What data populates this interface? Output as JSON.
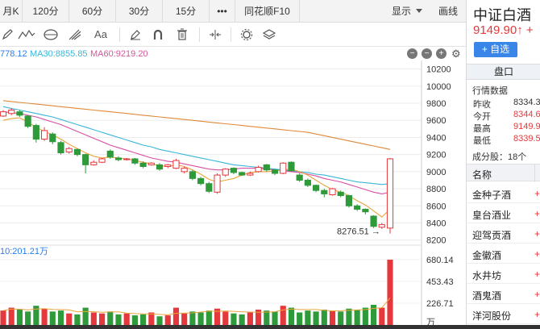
{
  "topbar": {
    "periods": [
      "月K",
      "120分",
      "60分",
      "30分",
      "15分",
      "•••",
      "同花顺F10"
    ],
    "display_label": "显示",
    "draw_label": "画线"
  },
  "toolbar": {
    "tools": [
      {
        "icon": "pencil-icon"
      },
      {
        "icon": "wave-line-icon"
      },
      {
        "icon": "cycle-icon"
      },
      {
        "icon": "fork-icon"
      },
      {
        "icon": "text-icon",
        "label": "Aa"
      },
      {
        "icon": "eraser-icon"
      },
      {
        "icon": "magnet-icon"
      },
      {
        "icon": "trash-icon"
      },
      {
        "icon": "split-icon"
      },
      {
        "icon": "settings-icon"
      },
      {
        "icon": "layers-icon"
      }
    ]
  },
  "ma_legend": {
    "ma_lead": "778.12",
    "ma30": "MA30:8855.85",
    "ma60": "MA60:9219.20",
    "colors": {
      "ma_lead": "#2a7be8",
      "ma30": "#39b6d8",
      "ma60": "#d6569b",
      "ma_long": "#e0893a",
      "ma_short": "#e9a53b",
      "ma_mid": "#d84fa3"
    }
  },
  "chart_data": {
    "type": "candlestick",
    "y_ticks": [
      "10200",
      "10000",
      "9800",
      "9600",
      "9400",
      "9200",
      "9000",
      "8800",
      "8600",
      "8400",
      "8200"
    ],
    "ylim": [
      8150,
      10300
    ],
    "min_marker": "8276.51",
    "volume_label": "10:201.21万",
    "volume_ticks": [
      "680.14",
      "453.43",
      "226.71",
      "万"
    ],
    "volume_max": 680.14,
    "candles": [
      {
        "o": 9650,
        "c": 9700,
        "h": 9720,
        "l": 9640
      },
      {
        "o": 9680,
        "c": 9720,
        "h": 9740,
        "l": 9660
      },
      {
        "o": 9700,
        "c": 9660,
        "h": 9720,
        "l": 9640
      },
      {
        "o": 9650,
        "c": 9530,
        "h": 9660,
        "l": 9510
      },
      {
        "o": 9540,
        "c": 9380,
        "h": 9560,
        "l": 9340
      },
      {
        "o": 9380,
        "c": 9480,
        "h": 9520,
        "l": 9360
      },
      {
        "o": 9440,
        "c": 9350,
        "h": 9460,
        "l": 9320
      },
      {
        "o": 9340,
        "c": 9220,
        "h": 9360,
        "l": 9200
      },
      {
        "o": 9230,
        "c": 9270,
        "h": 9290,
        "l": 9210
      },
      {
        "o": 9260,
        "c": 9200,
        "h": 9270,
        "l": 9180
      },
      {
        "o": 9200,
        "c": 9080,
        "h": 9210,
        "l": 8980
      },
      {
        "o": 9080,
        "c": 9110,
        "h": 9130,
        "l": 9070
      },
      {
        "o": 9110,
        "c": 9150,
        "h": 9160,
        "l": 9100
      },
      {
        "o": 9240,
        "c": 9170,
        "h": 9260,
        "l": 9150
      },
      {
        "o": 9160,
        "c": 9140,
        "h": 9180,
        "l": 9120
      },
      {
        "o": 9140,
        "c": 9150,
        "h": 9160,
        "l": 9130
      },
      {
        "o": 9150,
        "c": 9100,
        "h": 9160,
        "l": 9080
      },
      {
        "o": 9100,
        "c": 9060,
        "h": 9120,
        "l": 9040
      },
      {
        "o": 9080,
        "c": 9100,
        "h": 9110,
        "l": 9070
      },
      {
        "o": 9080,
        "c": 9030,
        "h": 9100,
        "l": 9010
      },
      {
        "o": 9060,
        "c": 9080,
        "h": 9090,
        "l": 9040
      },
      {
        "o": 9040,
        "c": 9130,
        "h": 9150,
        "l": 9030
      },
      {
        "o": 9000,
        "c": 9040,
        "h": 9060,
        "l": 8980
      },
      {
        "o": 9000,
        "c": 8920,
        "h": 9020,
        "l": 8900
      },
      {
        "o": 8920,
        "c": 8860,
        "h": 8940,
        "l": 8840
      },
      {
        "o": 8860,
        "c": 8770,
        "h": 8880,
        "l": 8750
      },
      {
        "o": 8760,
        "c": 8960,
        "h": 8980,
        "l": 8740
      },
      {
        "o": 8960,
        "c": 9030,
        "h": 9040,
        "l": 8940
      },
      {
        "o": 9040,
        "c": 8990,
        "h": 9050,
        "l": 8970
      },
      {
        "o": 8990,
        "c": 8960,
        "h": 9000,
        "l": 8950
      },
      {
        "o": 8960,
        "c": 8980,
        "h": 9000,
        "l": 8950
      },
      {
        "o": 9000,
        "c": 9050,
        "h": 9070,
        "l": 8990
      },
      {
        "o": 9080,
        "c": 9020,
        "h": 9090,
        "l": 9000
      },
      {
        "o": 9020,
        "c": 8980,
        "h": 9030,
        "l": 8960
      },
      {
        "o": 8980,
        "c": 9100,
        "h": 9110,
        "l": 8970
      },
      {
        "o": 9110,
        "c": 9010,
        "h": 9120,
        "l": 9000
      },
      {
        "o": 8960,
        "c": 8900,
        "h": 8980,
        "l": 8880
      },
      {
        "o": 8900,
        "c": 8840,
        "h": 8920,
        "l": 8820
      },
      {
        "o": 8840,
        "c": 8780,
        "h": 8850,
        "l": 8760
      },
      {
        "o": 8780,
        "c": 8740,
        "h": 8800,
        "l": 8700
      },
      {
        "o": 8730,
        "c": 8800,
        "h": 8810,
        "l": 8720
      },
      {
        "o": 8760,
        "c": 8720,
        "h": 8780,
        "l": 8700
      },
      {
        "o": 8720,
        "c": 8600,
        "h": 8730,
        "l": 8580
      },
      {
        "o": 8600,
        "c": 8560,
        "h": 8620,
        "l": 8540
      },
      {
        "o": 8560,
        "c": 8530,
        "h": 8570,
        "l": 8500
      },
      {
        "o": 8480,
        "c": 8360,
        "h": 8490,
        "l": 8340
      },
      {
        "o": 8350,
        "c": 8380,
        "h": 8400,
        "l": 8330
      },
      {
        "o": 8340,
        "c": 9150,
        "h": 9160,
        "l": 8276
      }
    ],
    "volumes": [
      150,
      180,
      160,
      140,
      200,
      170,
      140,
      150,
      120,
      110,
      180,
      130,
      120,
      140,
      110,
      120,
      100,
      110,
      130,
      90,
      100,
      180,
      120,
      140,
      130,
      150,
      170,
      140,
      120,
      110,
      130,
      160,
      150,
      140,
      200,
      180,
      130,
      150,
      140,
      160,
      150,
      140,
      170,
      160,
      180,
      210,
      180,
      680
    ],
    "ma_short": [
      9600,
      9620,
      9630,
      9580,
      9520,
      9470,
      9430,
      9380,
      9320,
      9270,
      9220,
      9180,
      9160,
      9170,
      9160,
      9150,
      9130,
      9110,
      9090,
      9070,
      9060,
      9080,
      9060,
      9020,
      8970,
      8910,
      8880,
      8900,
      8920,
      8960,
      8990,
      9000,
      9000,
      9010,
      9020,
      9030,
      9000,
      8960,
      8900,
      8840,
      8790,
      8760,
      8720,
      8660,
      8610,
      8540,
      8470,
      8560
    ],
    "ma_mid": [
      9700,
      9690,
      9680,
      9660,
      9640,
      9610,
      9580,
      9550,
      9510,
      9470,
      9430,
      9390,
      9350,
      9310,
      9280,
      9250,
      9220,
      9190,
      9160,
      9140,
      9120,
      9110,
      9090,
      9070,
      9050,
      9030,
      9020,
      9020,
      9030,
      9040,
      9040,
      9040,
      9030,
      9020,
      9010,
      9000,
      8990,
      8970,
      8950,
      8920,
      8900,
      8880,
      8850,
      8820,
      8790,
      8760,
      8740,
      8760
    ],
    "ma30": [
      9760,
      9740,
      9720,
      9700,
      9680,
      9660,
      9640,
      9610,
      9580,
      9550,
      9520,
      9490,
      9460,
      9430,
      9400,
      9370,
      9340,
      9310,
      9290,
      9260,
      9240,
      9220,
      9200,
      9180,
      9160,
      9140,
      9120,
      9100,
      9080,
      9070,
      9060,
      9050,
      9040,
      9030,
      9020,
      9010,
      9000,
      8990,
      8970,
      8960,
      8940,
      8920,
      8900,
      8880,
      8870,
      8860,
      8850,
      8860
    ],
    "ma60": [
      9830,
      9820,
      9810,
      9800,
      9790,
      9780,
      9770,
      9760,
      9750,
      9740,
      9730,
      9720,
      9710,
      9700,
      9690,
      9680,
      9670,
      9660,
      9650,
      9640,
      9630,
      9620,
      9610,
      9600,
      9590,
      9580,
      9570,
      9560,
      9550,
      9540,
      9530,
      9520,
      9510,
      9500,
      9490,
      9480,
      9470,
      9460,
      9440,
      9420,
      9400,
      9380,
      9360,
      9340,
      9320,
      9300,
      9280,
      9260
    ]
  },
  "sidebar": {
    "title": "中证白酒",
    "price": "9149.90↑ +",
    "add_label": "+ 自选",
    "tab_label": "盘口",
    "section_label": "行情数据",
    "quotes": [
      {
        "label": "昨收",
        "value": "8334.3"
      },
      {
        "label": "今开",
        "value": "8344.6"
      },
      {
        "label": "最高",
        "value": "9149.9"
      },
      {
        "label": "最低",
        "value": "8339.5"
      }
    ],
    "components_label": "成分股：18个",
    "col_header": "名称",
    "constituents": [
      "金种子酒",
      "皇台酒业",
      "迎驾贡酒",
      "金徽酒",
      "水井坊",
      "酒鬼酒",
      "洋河股份"
    ]
  }
}
